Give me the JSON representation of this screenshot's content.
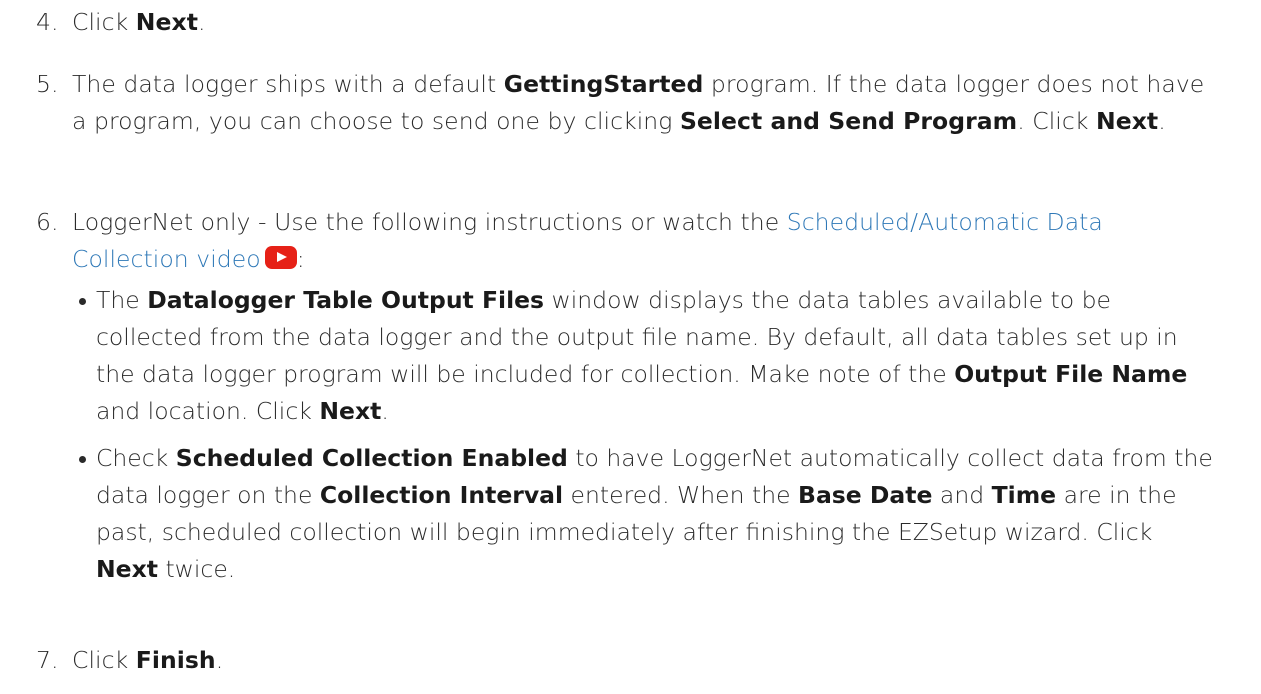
{
  "steps": [
    {
      "num": "4.",
      "segments": [
        {
          "t": "Click ",
          "s": "plain"
        },
        {
          "t": "Next",
          "s": "bold"
        },
        {
          "t": ".",
          "s": "plain"
        }
      ]
    },
    {
      "num": "5.",
      "segments": [
        {
          "t": "The data logger ships with a default ",
          "s": "plain"
        },
        {
          "t": "GettingStarted",
          "s": "bold"
        },
        {
          "t": " program. If the data logger does not have a program, you can choose to send one by clicking ",
          "s": "plain"
        },
        {
          "t": "Select and Send Program",
          "s": "bold"
        },
        {
          "t": ". Click ",
          "s": "plain"
        },
        {
          "t": "Next",
          "s": "bold"
        },
        {
          "t": ".",
          "s": "plain"
        }
      ]
    },
    {
      "num": "6.",
      "segments": [
        {
          "t": "LoggerNet only - Use the following instructions or watch the ",
          "s": "plain"
        },
        {
          "t": "Scheduled/Automatic Data Collection video",
          "s": "link"
        },
        {
          "t": "youtube-play-icon",
          "s": "icon"
        },
        {
          "t": ":",
          "s": "plain"
        }
      ],
      "bullets": [
        {
          "segments": [
            {
              "t": "The ",
              "s": "plain"
            },
            {
              "t": "Datalogger Table Output Files",
              "s": "bold"
            },
            {
              "t": " window displays the data tables available to be collected from the data logger and the output file name. By default, all data tables set up in the data logger program will be included for collection. Make note of the ",
              "s": "plain"
            },
            {
              "t": "Output File Name",
              "s": "bold"
            },
            {
              "t": " and location. Click ",
              "s": "plain"
            },
            {
              "t": "Next",
              "s": "bold"
            },
            {
              "t": ".",
              "s": "plain"
            }
          ]
        },
        {
          "segments": [
            {
              "t": "Check ",
              "s": "plain"
            },
            {
              "t": "Scheduled Collection Enabled",
              "s": "bold"
            },
            {
              "t": " to have LoggerNet automatically collect data from the data logger on the ",
              "s": "plain"
            },
            {
              "t": "Collection Interval",
              "s": "bold"
            },
            {
              "t": " entered. When the ",
              "s": "plain"
            },
            {
              "t": "Base Date",
              "s": "bold"
            },
            {
              "t": " and ",
              "s": "plain"
            },
            {
              "t": "Time",
              "s": "bold"
            },
            {
              "t": " are in the past, scheduled collection will begin immediately after finishing the EZSetup wizard. Click ",
              "s": "plain"
            },
            {
              "t": "Next",
              "s": "bold"
            },
            {
              "t": " twice.",
              "s": "plain"
            }
          ]
        }
      ]
    },
    {
      "num": "7.",
      "segments": [
        {
          "t": "Click ",
          "s": "plain"
        },
        {
          "t": "Finish",
          "s": "bold"
        },
        {
          "t": ".",
          "s": "plain"
        }
      ]
    }
  ],
  "colors": {
    "link": "#2e78b7",
    "youtube_icon": "#e62117",
    "text": "#2a2a2a"
  }
}
